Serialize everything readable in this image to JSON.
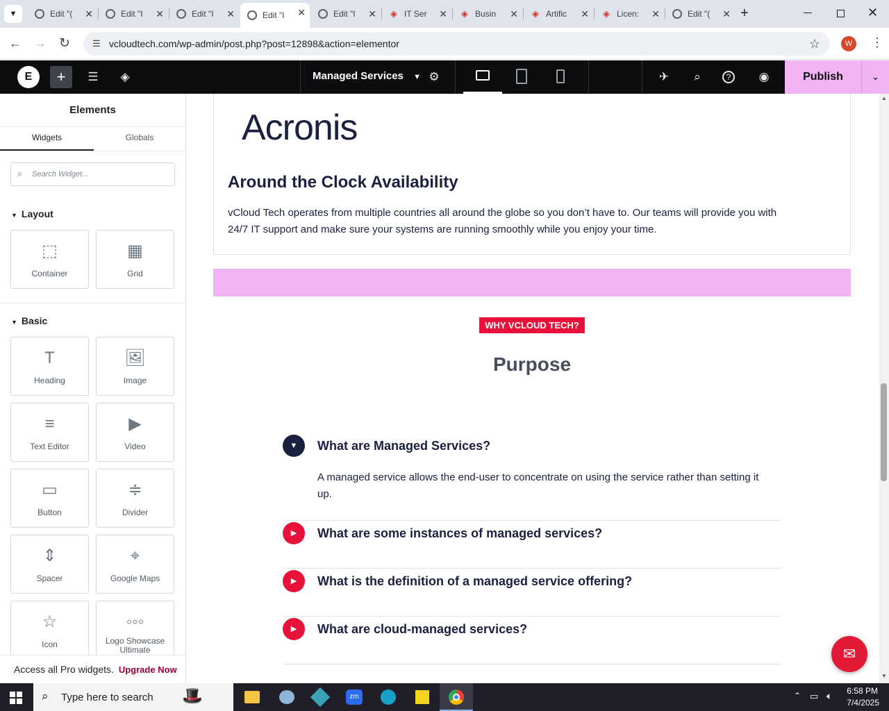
{
  "browser": {
    "tabs": [
      {
        "title": "Edit \"(",
        "icon": "globe-icon"
      },
      {
        "title": "Edit \"I",
        "icon": "globe-icon"
      },
      {
        "title": "Edit \"I",
        "icon": "globe-icon"
      },
      {
        "title": "Edit \"I",
        "icon": "globe-icon",
        "active": true
      },
      {
        "title": "Edit \"I",
        "icon": "globe-icon"
      },
      {
        "title": "IT Ser",
        "icon": "diamond-icon"
      },
      {
        "title": "Busin",
        "icon": "diamond-icon"
      },
      {
        "title": "Artific",
        "icon": "diamond-icon"
      },
      {
        "title": "Licen:",
        "icon": "diamond-icon"
      },
      {
        "title": "Edit \"(",
        "icon": "globe-icon"
      }
    ],
    "url": "vcloudtech.com/wp-admin/post.php?post=12898&action=elementor",
    "profile_initial": "W"
  },
  "editor": {
    "page_name": "Managed Services",
    "publish_label": "Publish"
  },
  "panel": {
    "title": "Elements",
    "tabs": [
      "Widgets",
      "Globals"
    ],
    "search_placeholder": "Search Widget...",
    "sections": {
      "layout": "Layout",
      "basic": "Basic"
    },
    "layout_widgets": [
      {
        "label": "Container",
        "icon": "container-icon"
      },
      {
        "label": "Grid",
        "icon": "grid-icon"
      }
    ],
    "basic_widgets": [
      {
        "label": "Heading",
        "icon": "heading-icon"
      },
      {
        "label": "Image",
        "icon": "image-icon"
      },
      {
        "label": "Text Editor",
        "icon": "text-editor-icon"
      },
      {
        "label": "Video",
        "icon": "video-icon"
      },
      {
        "label": "Button",
        "icon": "button-icon"
      },
      {
        "label": "Divider",
        "icon": "divider-icon"
      },
      {
        "label": "Spacer",
        "icon": "spacer-icon"
      },
      {
        "label": "Google Maps",
        "icon": "map-icon"
      },
      {
        "label": "Icon",
        "icon": "star-icon"
      },
      {
        "label": "Logo Showcase Ultimate",
        "icon": "logo-showcase-icon"
      }
    ],
    "promo_text": "Access all Pro widgets.",
    "promo_link": "Upgrade Now"
  },
  "canvas": {
    "logo_text": "Acronis",
    "heading": "Around the Clock Availability",
    "paragraph": "vCloud Tech operates from multiple countries all around the globe so you don’t have to. Our teams will provide you with 24/7 IT support and make sure your systems are running smoothly while you enjoy your time.",
    "badge": "WHY VCLOUD TECH?",
    "section_title": "Purpose",
    "accordion": [
      {
        "question": "What are Managed Services?",
        "answer": "A managed service allows the end-user to concentrate on using the service rather than setting it up.",
        "open": true
      },
      {
        "question": "What are some instances of managed services?",
        "open": false
      },
      {
        "question": "What is the definition of a managed service offering?",
        "open": false
      },
      {
        "question": "What are cloud-managed services?",
        "open": false
      }
    ]
  },
  "taskbar": {
    "search_placeholder": "Type here to search",
    "time": "6:58 PM",
    "date": "7/4/2025"
  },
  "colors": {
    "accent_pink": "#f0b4f5",
    "badge_red": "#e8113a",
    "accordion_red": "#e8113a",
    "navy": "#1a2140"
  }
}
